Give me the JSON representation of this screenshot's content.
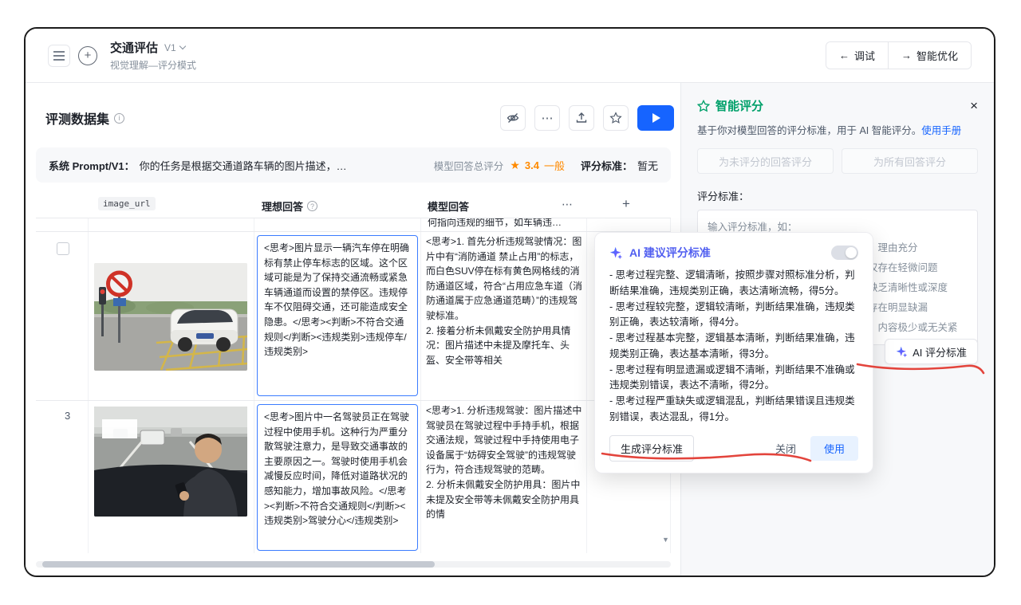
{
  "header": {
    "title": "交通评估",
    "version": "V1",
    "subtitle": "视觉理解—评分模式",
    "debug": "调试",
    "optimize": "智能优化"
  },
  "main": {
    "dataset_title": "评测数据集"
  },
  "prompt_bar": {
    "label": "系统 Prompt/V1：",
    "text": "你的任务是根据交通道路车辆的图片描述，…",
    "score_label": "模型回答总评分",
    "score": "3.4",
    "score_level": "一般",
    "standard_label": "评分标准：",
    "standard_value": "暂无"
  },
  "table": {
    "col_image": "image_url",
    "col_ideal": "理想回答",
    "col_model": "模型回答",
    "partial_tail": "何指向违规的细节，如车辆违…",
    "rows": [
      {
        "ideal": "<思考>图片显示一辆汽车停在明确标有禁止停车标志的区域。这个区域可能是为了保持交通流畅或紧急车辆通道而设置的禁停区。违规停车不仅阻碍交通，还可能造成安全隐患。</思考><判断>不符合交通规则</判断><违规类别>违规停车/违规类别>",
        "model": "<思考>1. 首先分析违规驾驶情况：图片中有“消防通道 禁止占用”的标志，而白色SUV停在标有黄色网格线的消防通道区域，符合“占用应急车道（消防通道属于应急通道范畴）”的违规驾驶标准。\n2. 接着分析未佩戴安全防护用具情况：图片描述中未提及摩托车、头盔、安全带等相关"
      },
      {
        "index": "3",
        "ideal": "<思考>图片中一名驾驶员正在驾驶过程中使用手机。这种行为严重分散驾驶注意力，是导致交通事故的主要原因之一。驾驶时使用手机会减慢反应时间，降低对道路状况的感知能力，增加事故风险。</思考><判断>不符合交通规则</判断><违规类别>驾驶分心</违规类别>",
        "model": "<思考>1. 分析违规驾驶：图片描述中驾驶员在驾驶过程中手持手机，根据交通法规，驾驶过程中手持使用电子设备属于“妨碍安全驾驶”的违规驾驶行为，符合违规驾驶的范畴。\n2. 分析未佩戴安全防护用具：图片中未提及安全带等未佩戴安全防护用具的情"
      }
    ]
  },
  "panel": {
    "title": "智能评分",
    "desc": "基于你对模型回答的评分标准，用于 AI 智能评分。",
    "manual_link": "使用手册",
    "score_unrated_btn": "为未评分的回答评分",
    "score_all_btn": "为所有回答评分",
    "standard_label": "评分标准：",
    "placeholder": "输入评分标准，如：",
    "example_fragments": [
      "，理由充分",
      "仅存在轻微问题",
      "缺乏清晰性或深度",
      "存在明显缺漏",
      "，内容极少或无关紧"
    ],
    "ai_standard_btn": "AI 评分标准"
  },
  "popup": {
    "title": "AI 建议评分标准",
    "items": [
      "- 思考过程完整、逻辑清晰，按照步骤对照标准分析，判断结果准确，违规类别正确，表达清晰流畅，得5分。",
      "- 思考过程较完整，逻辑较清晰，判断结果准确，违规类别正确，表达较清晰，得4分。",
      "- 思考过程基本完整，逻辑基本清晰，判断结果准确，违规类别正确，表达基本清晰，得3分。",
      "- 思考过程有明显遗漏或逻辑不清晰，判断结果不准确或违规类别错误，表达不清晰，得2分。",
      "- 思考过程严重缺失或逻辑混乱，判断结果错误且违规类别错误，表达混乱，得1分。"
    ],
    "generate_btn": "生成评分标准",
    "close_btn": "关闭",
    "use_btn": "使用"
  },
  "icons": {
    "more": "⋯",
    "add": "+",
    "close": "×",
    "rating_star": "★",
    "down": "▼",
    "info": "i",
    "help": "?",
    "arrow_left": "←",
    "arrow_right": "→",
    "plus": "+"
  }
}
